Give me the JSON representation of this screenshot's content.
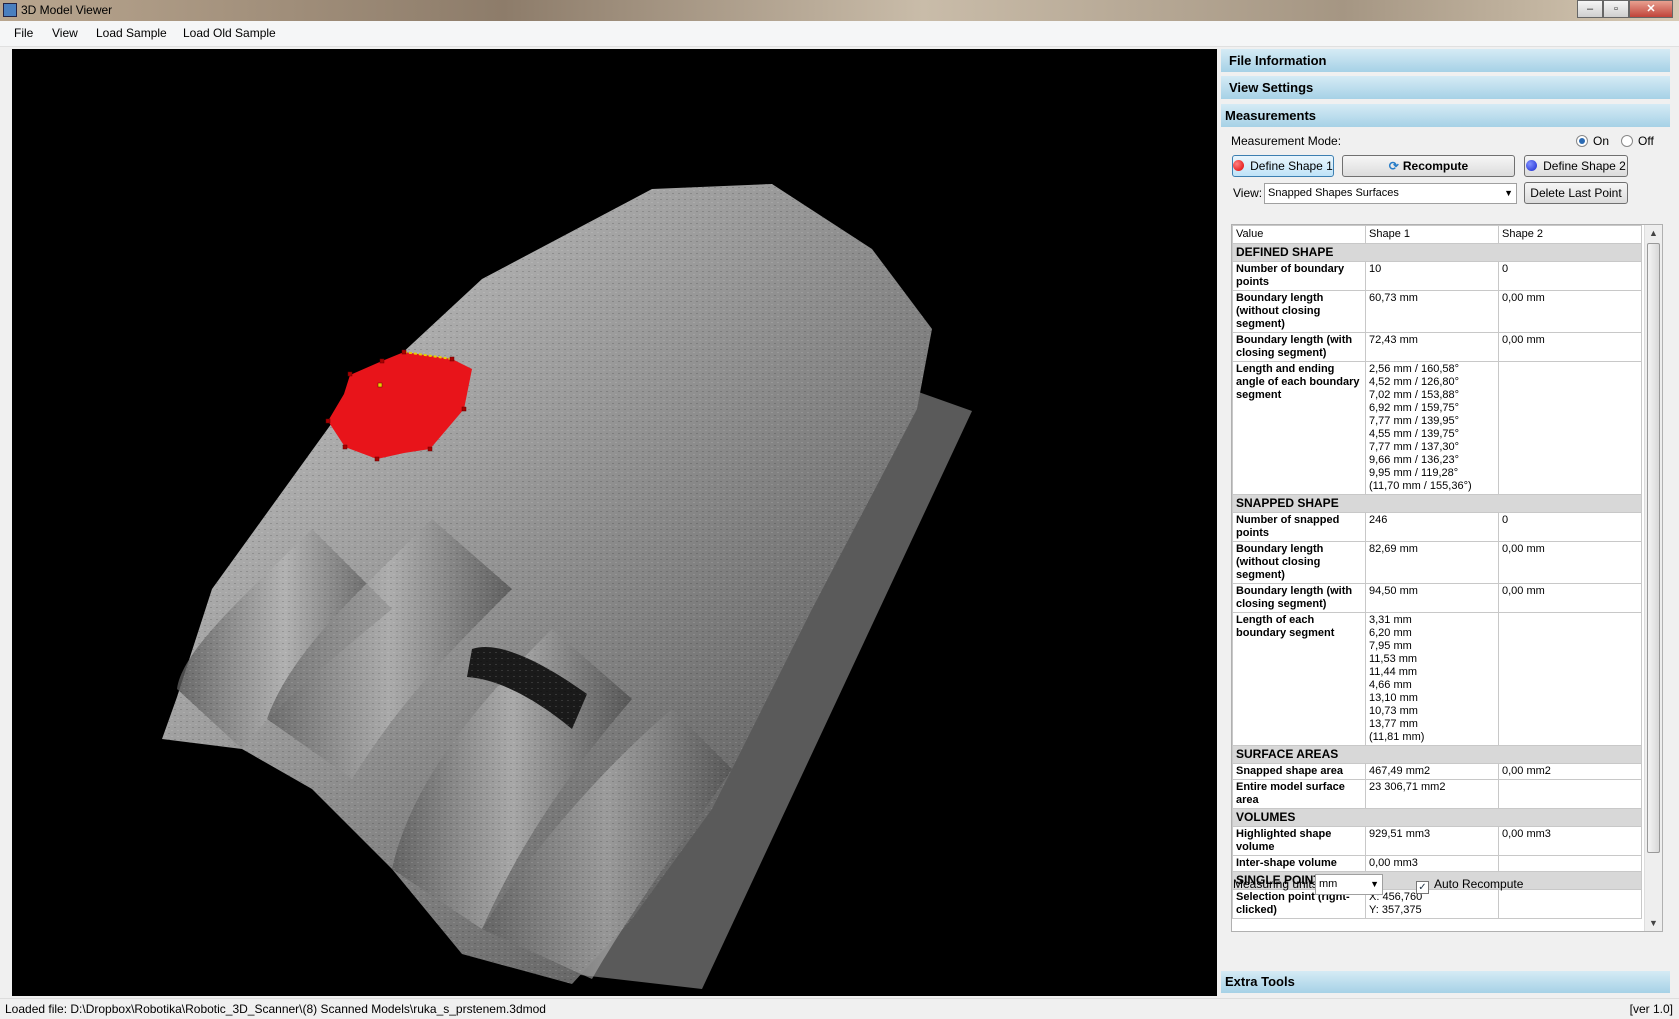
{
  "window": {
    "title": "3D Model Viewer",
    "buttons": [
      "–",
      "▫",
      "✕"
    ]
  },
  "menu": {
    "items": [
      "File",
      "View",
      "Load Sample",
      "Load Old Sample"
    ]
  },
  "panel": {
    "sections": {
      "file_info": "File Information",
      "view_settings": "View Settings",
      "measurements": "Measurements",
      "extra_tools": "Extra Tools"
    },
    "measurement_mode": {
      "label": "Measurement Mode:",
      "on": "On",
      "off": "Off",
      "selected": "On"
    },
    "buttons": {
      "define_shape_1": "Define Shape 1",
      "recompute": "Recompute",
      "define_shape_2": "Define Shape 2",
      "delete_last_point": "Delete Last Point"
    },
    "view": {
      "label": "View:",
      "value": "Snapped Shapes Surfaces"
    },
    "grid": {
      "headers": [
        "Value",
        "Shape 1",
        "Shape 2"
      ],
      "groups": {
        "defined": "DEFINED SHAPE",
        "snapped": "SNAPPED SHAPE",
        "surface": "SURFACE AREAS",
        "volumes": "VOLUMES",
        "single": "SINGLE POINT"
      },
      "defined_rows": [
        {
          "label": "Number of boundary points",
          "s1": "10",
          "s2": "0"
        },
        {
          "label": "Boundary length (without closing segment)",
          "s1": "60,73 mm",
          "s2": "0,00 mm"
        },
        {
          "label": "Boundary length (with closing segment)",
          "s1": "72,43 mm",
          "s2": "0,00 mm"
        },
        {
          "label": "Length and ending angle of each boundary segment",
          "s1": "2,56 mm / 160,58°\n4,52 mm / 126,80°\n7,02 mm / 153,88°\n6,92 mm / 159,75°\n7,77 mm / 139,95°\n4,55 mm / 139,75°\n7,77 mm / 137,30°\n9,66 mm / 136,23°\n9,95 mm / 119,28°\n(11,70 mm / 155,36°)",
          "s2": ""
        }
      ],
      "snapped_rows": [
        {
          "label": "Number of snapped points",
          "s1": "246",
          "s2": "0"
        },
        {
          "label": "Boundary length (without closing segment)",
          "s1": "82,69 mm",
          "s2": "0,00 mm"
        },
        {
          "label": "Boundary length (with closing segment)",
          "s1": "94,50 mm",
          "s2": "0,00 mm"
        },
        {
          "label": "Length of each boundary segment",
          "s1": "3,31 mm\n6,20 mm\n7,95 mm\n11,53 mm\n11,44 mm\n4,66 mm\n13,10 mm\n10,73 mm\n13,77 mm\n(11,81 mm)",
          "s2": ""
        }
      ],
      "surface_rows": [
        {
          "label": "Snapped shape area",
          "s1": "467,49 mm2",
          "s2": "0,00 mm2"
        },
        {
          "label": "Entire model surface area",
          "s1": "23 306,71 mm2",
          "s2": ""
        }
      ],
      "volume_rows": [
        {
          "label": "Highlighted shape volume",
          "s1": "929,51 mm3",
          "s2": "0,00 mm3"
        },
        {
          "label": "Inter-shape volume",
          "s1": "0,00 mm3",
          "s2": ""
        }
      ],
      "single_rows": [
        {
          "label": "Selection point (right-clicked)",
          "s1": "X: 456,760\nY: 357,375",
          "s2": ""
        }
      ]
    },
    "units": {
      "label": "Measuring units:",
      "value": "mm"
    },
    "auto_recompute": {
      "label": "Auto Recompute",
      "checked": true
    }
  },
  "status": {
    "loaded": "Loaded file: D:\\Dropbox\\Robotika\\Robotic_3D_Scanner\\(8) Scanned Models\\ruka_s_prstenem.3dmod",
    "version": "[ver 1.0]"
  },
  "colors": {
    "shape1": "#e8141a",
    "shape2": "#2233cc",
    "header": "#a6d1e6"
  }
}
